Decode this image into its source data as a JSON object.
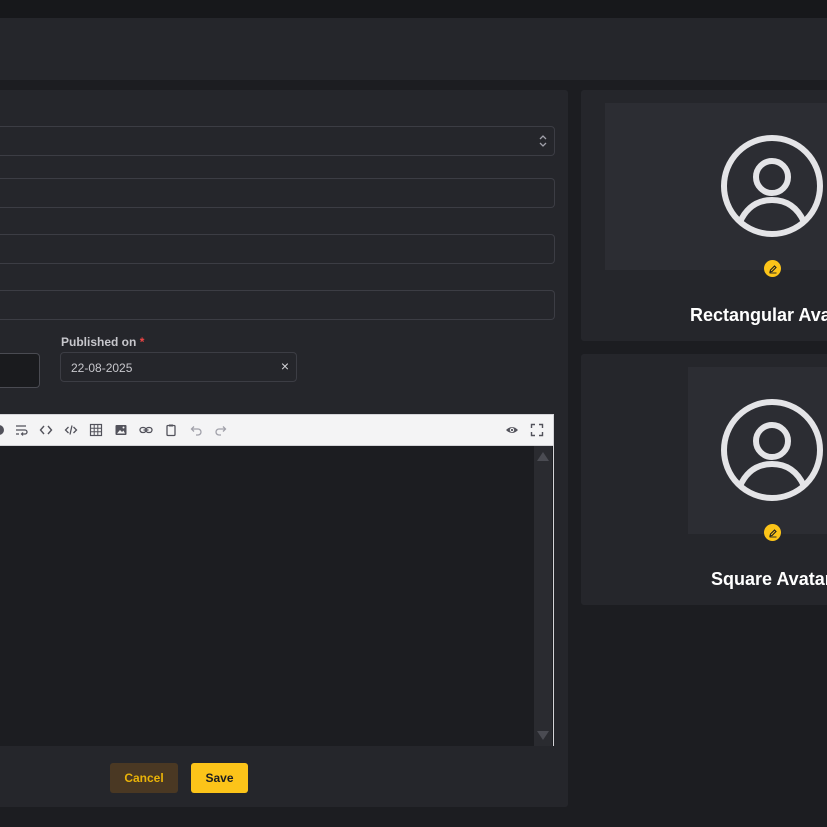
{
  "form": {
    "published_label": "Published on",
    "required_mark": "*",
    "published_value": "22-08-2025",
    "clear_symbol": "×"
  },
  "editor": {
    "toolbar_icons": [
      "wrap-icon",
      "code-inline-icon",
      "code-block-icon",
      "table-icon",
      "image-icon",
      "link-icon",
      "clipboard-icon",
      "undo-icon",
      "redo-icon",
      "preview-eye-icon",
      "fullscreen-icon"
    ]
  },
  "actions": {
    "cancel_label": "Cancel",
    "save_label": "Save"
  },
  "avatars": {
    "rectangular_title": "Rectangular Avatar",
    "square_title": "Square Avatar"
  },
  "colors": {
    "accent": "#fcc419",
    "background": "#1c1d21",
    "card": "#25262b",
    "required": "#ef4444"
  }
}
